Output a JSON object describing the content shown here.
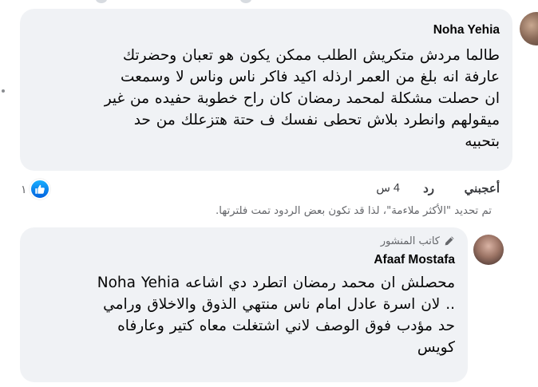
{
  "comment": {
    "author": "Noha Yehia",
    "lines": [
      "طالما مردش متكريش الطلب ممكن يكون هو تعبان وحضرتك",
      "عارفة انه بلغ من العمر ارذله اكيد فاكر ناس وناس لا وسمعت",
      "ان حصلت مشكلة لمحمد رمضان كان راح خطوبة حفيده من غير",
      "ميقولهم وانطرد بلاش تحطى نفسك ف حتة هتزعلك من حد",
      "بتحبيه"
    ],
    "like_label": "أعجبني",
    "reply_label": "رد",
    "time": "4 س",
    "reaction_count": "١",
    "reaction_icon": "like-thumb-icon"
  },
  "filter_note": "تم تحديد \"الأكثر ملاءمة\"، لذا قد تكون بعض الردود تمت فلترتها.",
  "reply": {
    "badge": "كاتب المنشور",
    "badge_icon": "pencil-icon",
    "author": "Afaaf Mostafa",
    "lines": [
      "محصلش ان محمد رمضان اتطرد دي اشاعه Noha Yehia",
      ".. لان اسرة عادل امام ناس منتهي الذوق والاخلاق ورامي",
      "حد مؤدب فوق الوصف لاني اشتغلت معاه كتير وعارفاه",
      "كويس"
    ]
  },
  "colors": {
    "bubble": "#f0f2f5",
    "text": "#050505",
    "secondary": "#65676b",
    "like_blue": "#1877f2"
  }
}
